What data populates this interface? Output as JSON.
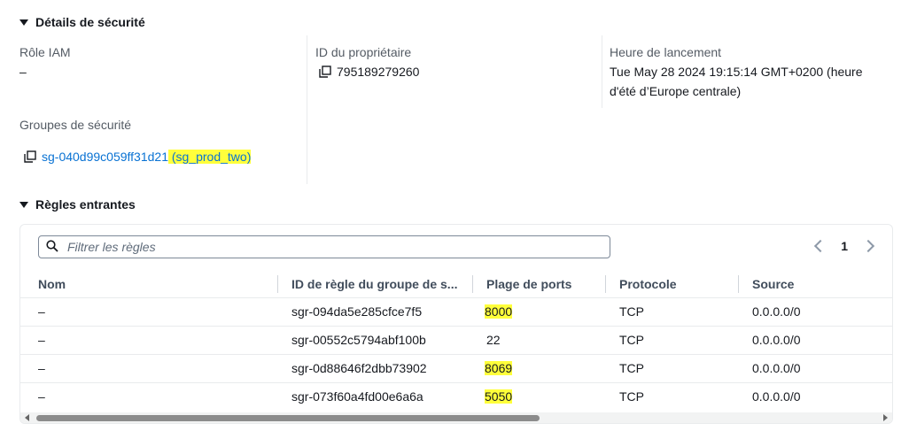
{
  "security_details": {
    "header": "Détails de sécurité",
    "iam_role": {
      "label": "Rôle IAM",
      "value": "–"
    },
    "owner_id": {
      "label": "ID du propriétaire",
      "value": "795189279260"
    },
    "launch_time": {
      "label": "Heure de lancement",
      "line1": "Tue May 28 2024 19:15:14 GMT+0200 (heure",
      "line2": "d'été d’Europe centrale)"
    },
    "security_groups": {
      "label": "Groupes de sécurité",
      "id": "sg-040d99c059ff31d21",
      "name": "(sg_prod_two)"
    }
  },
  "inbound_rules": {
    "header": "Règles entrantes",
    "filter_placeholder": "Filtrer les règles",
    "page": "1",
    "columns": [
      "Nom",
      "ID de règle du groupe de s...",
      "Plage de ports",
      "Protocole",
      "Source"
    ],
    "rows": [
      {
        "name": "–",
        "rule_id": "sgr-094da5e285cfce7f5",
        "port": "8000",
        "protocol": "TCP",
        "source": "0.0.0.0/0"
      },
      {
        "name": "–",
        "rule_id": "sgr-00552c5794abf100b",
        "port": "22",
        "protocol": "TCP",
        "source": "0.0.0.0/0"
      },
      {
        "name": "–",
        "rule_id": "sgr-0d88646f2dbb73902",
        "port": "8069",
        "protocol": "TCP",
        "source": "0.0.0.0/0"
      },
      {
        "name": "–",
        "rule_id": "sgr-073f60a4fd00e6a6a",
        "port": "5050",
        "protocol": "TCP",
        "source": "0.0.0.0/0"
      }
    ]
  },
  "colors": {
    "link": "#0972d3",
    "highlight": "#ffff3b",
    "border": "#e9ebed",
    "muted_text": "#545b64"
  },
  "icons": [
    "caret-down-icon",
    "copy-icon",
    "search-icon",
    "chevron-left-icon",
    "chevron-right-icon"
  ]
}
